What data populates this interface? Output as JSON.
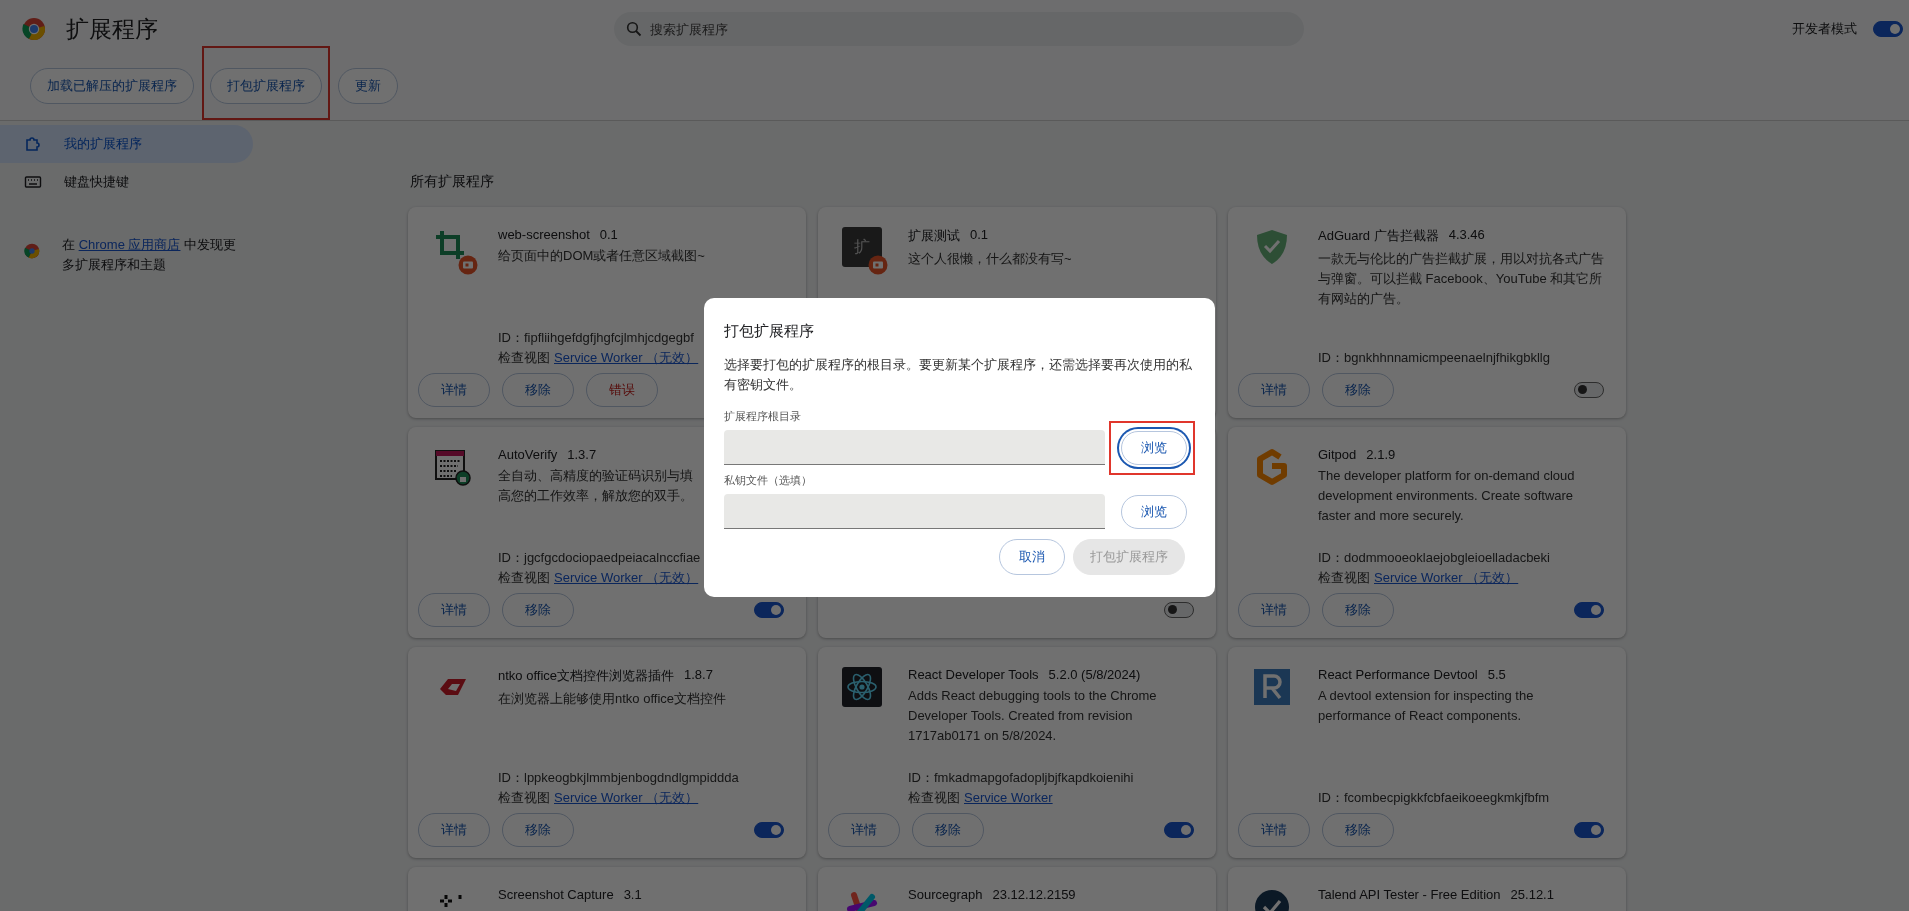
{
  "header": {
    "title": "扩展程序",
    "search": {
      "placeholder": "搜索扩展程序"
    },
    "developer_mode": {
      "label": "开发者模式",
      "on": true
    }
  },
  "toolbar": [
    {
      "label": "加载已解压的扩展程序",
      "highlighted": false
    },
    {
      "label": "打包扩展程序",
      "highlighted": true
    },
    {
      "label": "更新",
      "highlighted": false
    }
  ],
  "sidebar": {
    "items": [
      {
        "label": "我的扩展程序",
        "selected": true
      },
      {
        "label": "键盘快捷键",
        "selected": false
      }
    ],
    "promo": {
      "before": "在 ",
      "link": "Chrome 应用商店",
      "after": " 中发现更多扩展程序和主题"
    }
  },
  "section_title": "所有扩展程序",
  "cards": [
    {
      "badge": true,
      "name": "web-screenshot",
      "version": "0.1",
      "description": [
        "给页面中的DOM或者任意区域截图~"
      ],
      "id": "ID：fipfliihgefdgfjhgfcjlmhjcdgegbf",
      "inspect": {
        "label": "检查视图",
        "link": "Service Worker （无效）"
      },
      "buttons": [
        {
          "label": "详情",
          "kind": "normal"
        },
        {
          "label": "移除",
          "kind": "normal"
        },
        {
          "label": "错误",
          "kind": "error"
        }
      ]
    },
    {
      "icon_text": "扩",
      "badge": true,
      "name": "扩展测试",
      "version": "0.1",
      "description": [
        "这个人很懒，什么都没有写~"
      ]
    },
    {
      "badge": false,
      "name": "AdGuard 广告拦截器",
      "version": "4.3.46",
      "description": [
        "一款无与伦比的广告拦截扩展，用以对抗各式广告",
        "与弹窗。可以拦截 Facebook、YouTube 和其它所",
        "有网站的广告。"
      ],
      "id": "ID：bgnkhhnnamicmpeenaelnjfhikgbkllg",
      "buttons": [
        {
          "label": "详情",
          "kind": "normal"
        },
        {
          "label": "移除",
          "kind": "normal"
        }
      ],
      "toggle": {
        "on": false
      }
    },
    {
      "badge": false,
      "name": "AutoVerify",
      "version": "1.3.7",
      "description": [
        "全自动、高精度的验证码识别与填",
        "高您的工作效率，解放您的双手。"
      ],
      "id": "ID：jgcfgcdociopaedpeiacalnccfiae",
      "inspect": {
        "label": "检查视图",
        "link": "Service Worker （无效）"
      },
      "buttons": [
        {
          "label": "详情",
          "kind": "normal"
        },
        {
          "label": "移除",
          "kind": "normal"
        }
      ],
      "toggle": {
        "on": true
      }
    },
    {
      "toggle": {
        "on": false
      }
    },
    {
      "badge": false,
      "name": "Gitpod",
      "version": "2.1.9",
      "description": [
        "The developer platform for on-demand cloud",
        "development environments. Create software",
        "faster and more securely."
      ],
      "id": "ID：dodmmooeoklaejobgleioelladacbeki",
      "inspect": {
        "label": "检查视图",
        "link": "Service Worker （无效）"
      },
      "buttons": [
        {
          "label": "详情",
          "kind": "normal"
        },
        {
          "label": "移除",
          "kind": "normal"
        }
      ],
      "toggle": {
        "on": true
      }
    },
    {
      "badge": false,
      "name": "ntko office文档控件浏览器插件",
      "version": "1.8.7",
      "description": [
        "在浏览器上能够使用ntko office文档控件"
      ],
      "id": "ID：lppkeogbkjlmmbjenbogdndlgmpiddda",
      "inspect": {
        "label": "检查视图",
        "link": "Service Worker （无效）"
      },
      "buttons": [
        {
          "label": "详情",
          "kind": "normal"
        },
        {
          "label": "移除",
          "kind": "normal"
        }
      ],
      "toggle": {
        "on": true
      }
    },
    {
      "badge": false,
      "name": "React Developer Tools",
      "version": "5.2.0 (5/8/2024)",
      "description": [
        "Adds React debugging tools to the Chrome",
        "Developer Tools. Created from revision",
        "1717ab0171 on 5/8/2024."
      ],
      "id": "ID：fmkadmapgofadopljbjfkapdkoienihi",
      "inspect": {
        "label": "检查视图",
        "link": "Service Worker"
      },
      "buttons": [
        {
          "label": "详情",
          "kind": "normal"
        },
        {
          "label": "移除",
          "kind": "normal"
        }
      ],
      "toggle": {
        "on": true
      }
    },
    {
      "badge": false,
      "name": "React Performance Devtool",
      "version": "5.5",
      "description": [
        "A devtool extension for inspecting the",
        "performance of React components."
      ],
      "id": "ID：fcombecpigkkfcbfaeikoeegkmkjfbfm",
      "buttons": [
        {
          "label": "详情",
          "kind": "normal"
        },
        {
          "label": "移除",
          "kind": "normal"
        }
      ],
      "toggle": {
        "on": true
      }
    },
    {
      "name": "Screenshot Capture",
      "version": "3.1"
    },
    {
      "name": "Sourcegraph",
      "version": "23.12.12.2159"
    },
    {
      "name": "Talend API Tester - Free Edition",
      "version": "25.12.1"
    }
  ],
  "dialog": {
    "title": "打包扩展程序",
    "description": "选择要打包的扩展程序的根目录。要更新某个扩展程序，还需选择要再次使用的私有密钥文件。",
    "fields": [
      {
        "label": "扩展程序根目录",
        "button": {
          "label": "浏览",
          "focused": true,
          "highlighted": true
        }
      },
      {
        "label": "私钥文件（选填）",
        "button": {
          "label": "浏览",
          "focused": false,
          "highlighted": false
        }
      }
    ],
    "actions": [
      {
        "label": "取消",
        "disabled": false
      },
      {
        "label": "打包扩展程序",
        "disabled": true
      }
    ]
  }
}
